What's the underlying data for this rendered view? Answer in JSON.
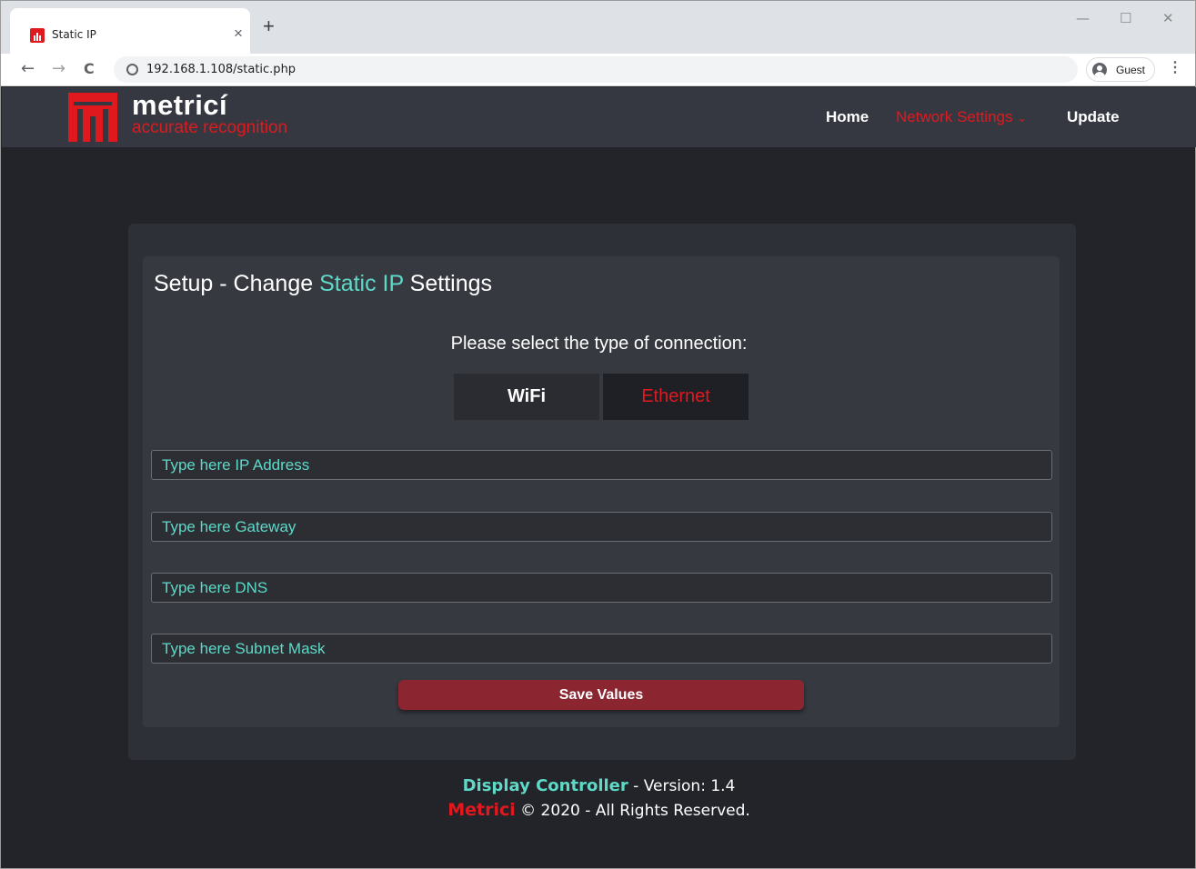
{
  "browser": {
    "tab_title": "Static IP",
    "tab_close": "×",
    "new_tab": "+",
    "url": "192.168.1.108/static.php",
    "profile_label": "Guest",
    "window_controls": {
      "minimize": "—",
      "maximize": "☐",
      "close": "✕"
    },
    "nav": {
      "back": "←",
      "forward": "→",
      "reload": "C"
    },
    "menu": "⋮"
  },
  "site": {
    "brand_name": "metricí",
    "brand_tagline": "accurate recognition",
    "nav": {
      "home": "Home",
      "network_settings": "Network Settings",
      "network_chevron": "⌄",
      "update": "Update"
    }
  },
  "form": {
    "title_prefix": "Setup - Change ",
    "title_accent": "Static IP",
    "title_suffix": " Settings",
    "prompt": "Please select the type of connection:",
    "connection_types": {
      "wifi": "WiFi",
      "ethernet": "Ethernet"
    },
    "selected_connection": "Ethernet",
    "fields": {
      "ip": {
        "placeholder": "Type here IP Address"
      },
      "gateway": {
        "placeholder": "Type here Gateway"
      },
      "dns": {
        "placeholder": "Type here DNS"
      },
      "subnet": {
        "placeholder": "Type here Subnet Mask"
      }
    },
    "save_label": "Save Values"
  },
  "footer": {
    "product": "Display Controller",
    "version_text": " - Version: 1.4",
    "brand": "Metrici",
    "copyright": " © 2020 - All Rights Reserved."
  },
  "colors": {
    "accent_teal": "#5ed9c8",
    "brand_red": "#e0191f",
    "page_bg": "#232429",
    "header_bg": "#353840",
    "save_button": "#8b2630"
  },
  "icons": {
    "favicon": "metrici-logo-icon",
    "info": "site-info-icon",
    "profile": "profile-avatar-icon",
    "logo": "metrici-logo-icon"
  }
}
